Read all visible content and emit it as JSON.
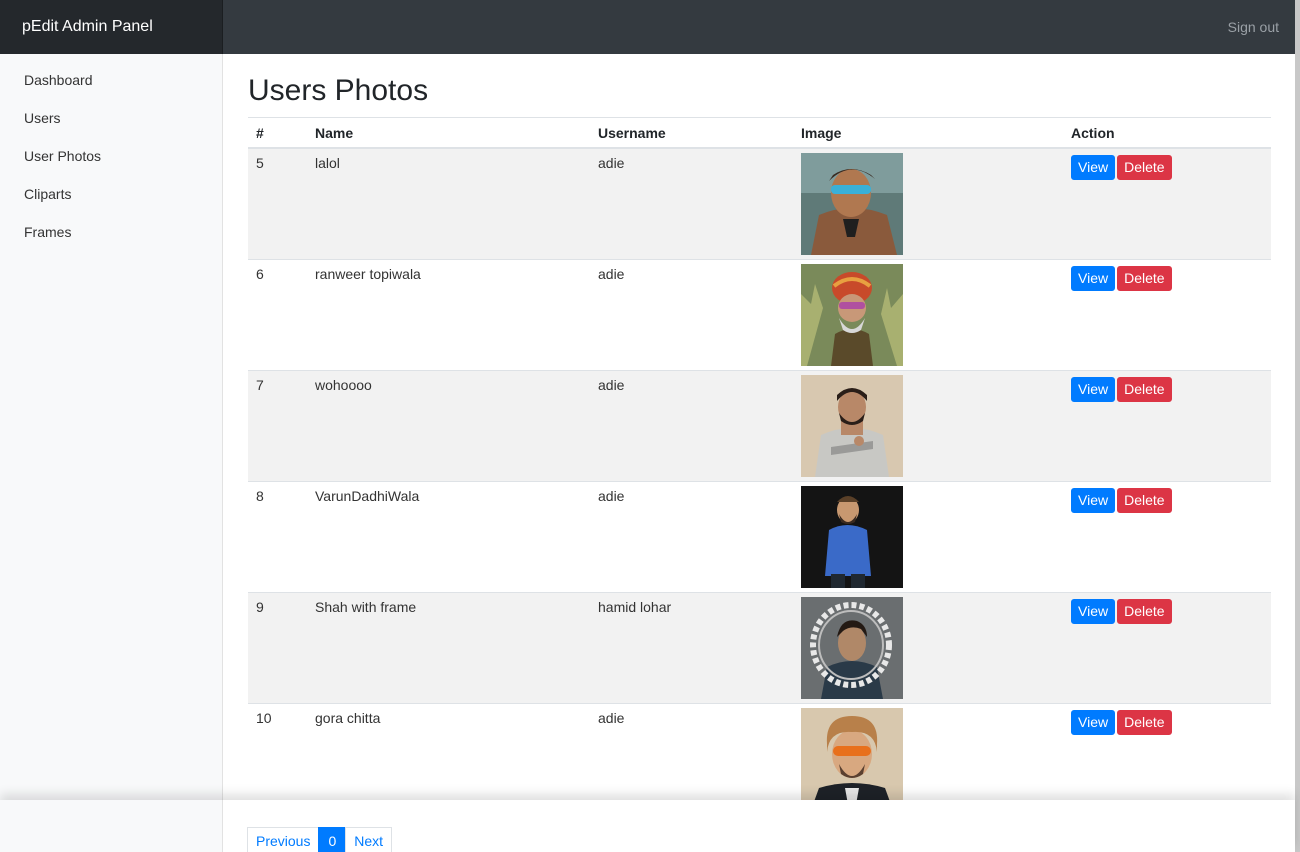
{
  "app": {
    "brand": "pEdit Admin Panel",
    "sign_out": "Sign out"
  },
  "sidebar": {
    "items": [
      {
        "label": "Dashboard"
      },
      {
        "label": "Users"
      },
      {
        "label": "User Photos"
      },
      {
        "label": "Cliparts"
      },
      {
        "label": "Frames"
      }
    ]
  },
  "main": {
    "title": "Users Photos",
    "columns": {
      "num": "#",
      "name": "Name",
      "username": "Username",
      "image": "Image",
      "action": "Action"
    },
    "view_label": "View",
    "delete_label": "Delete",
    "rows": [
      {
        "id": "5",
        "name": "lalol",
        "username": "adie"
      },
      {
        "id": "6",
        "name": "ranweer topiwala",
        "username": "adie"
      },
      {
        "id": "7",
        "name": "wohoooo",
        "username": "adie"
      },
      {
        "id": "8",
        "name": "VarunDadhiWala",
        "username": "adie"
      },
      {
        "id": "9",
        "name": "Shah with frame",
        "username": "hamid lohar"
      },
      {
        "id": "10",
        "name": "gora chitta",
        "username": "adie"
      }
    ]
  },
  "pagination": {
    "previous": "Previous",
    "current": "0",
    "next": "Next"
  },
  "colors": {
    "topbar": "#343a40",
    "primary": "#007bff",
    "danger": "#dc3545"
  }
}
